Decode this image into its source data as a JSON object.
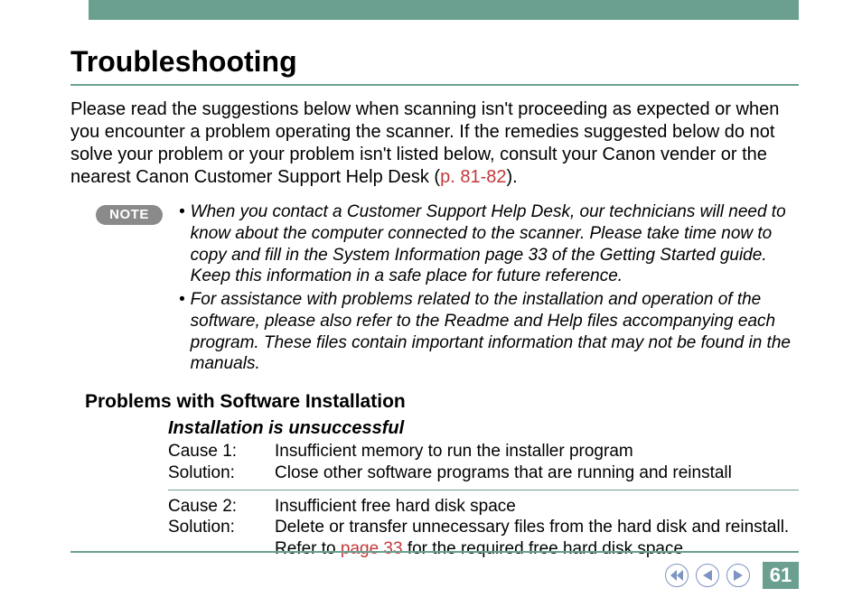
{
  "page": {
    "title": "Troubleshooting",
    "intro_before": "Please read the suggestions below when scanning isn't proceeding as expected or when you encounter a problem operating the scanner. If the remedies suggested below do not solve your problem or your problem isn't listed below, consult your Canon vender or the nearest Canon Customer Support Help Desk (",
    "intro_link": "p. 81-82",
    "intro_after": ").",
    "note_label": "NOTE",
    "notes": [
      "When you contact a Customer Support Help Desk, our technicians will need to know about the computer connected to the scanner. Please take time now to copy and fill in the System Information page 33 of the Getting Started guide. Keep this information in a safe place for future reference.",
      "For assistance with problems related to the installation and operation of the software, please also refer to the Readme and Help files accompanying each program. These files contain important information that may not be found in the manuals."
    ],
    "subsection": "Problems with Software Installation",
    "problem": "Installation is unsuccessful",
    "items": [
      {
        "cause_label": "Cause 1:",
        "cause": "Insufficient memory to run the installer program",
        "sol_label": "Solution:",
        "sol": "Close other software programs that are running and reinstall"
      },
      {
        "cause_label": "Cause 2:",
        "cause": "Insufficient free hard disk space",
        "sol_label": "Solution:",
        "sol_before": "Delete or transfer unnecessary files from the hard disk and reinstall. Refer to ",
        "sol_link": "page 33",
        "sol_after": " for the required free hard disk space"
      }
    ],
    "page_number": "61"
  }
}
